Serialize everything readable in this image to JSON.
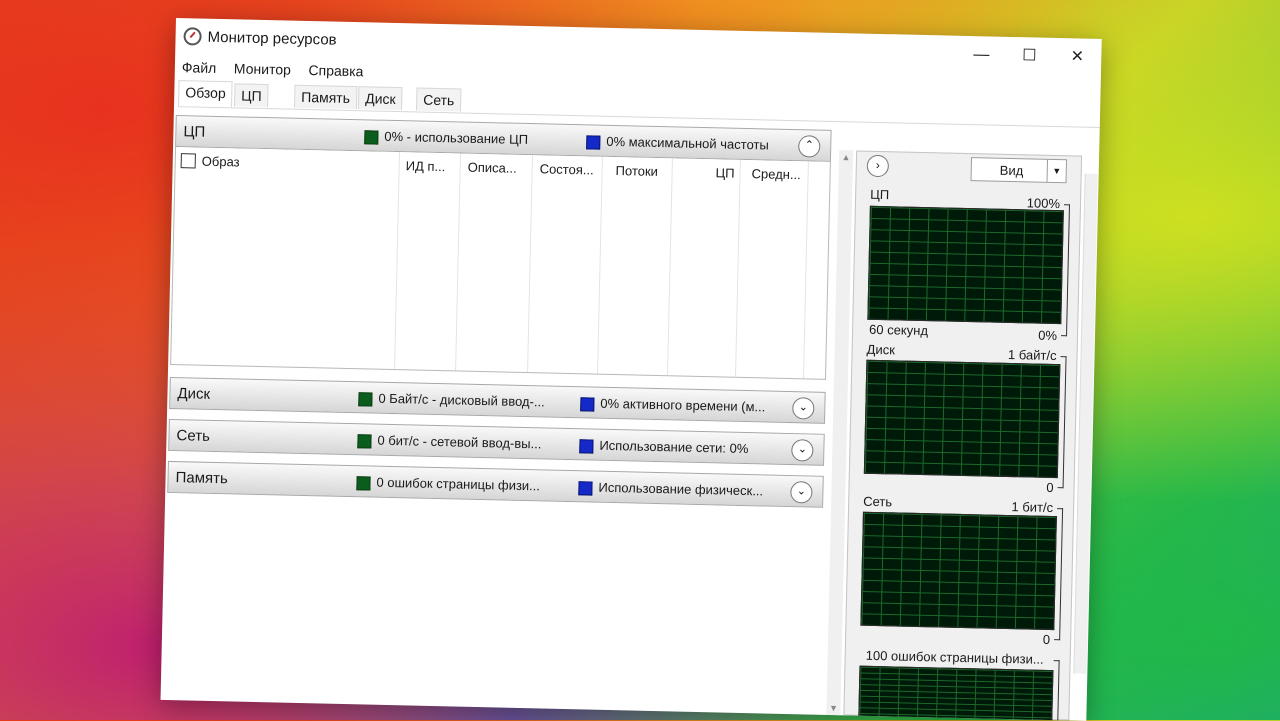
{
  "window": {
    "title": "Монитор ресурсов",
    "controls": {
      "minimize": "—",
      "maximize": "☐",
      "close": "✕"
    }
  },
  "menu": [
    "Файл",
    "Монитор",
    "Справка"
  ],
  "tabs": [
    "Обзор",
    "ЦП",
    "Память",
    "Диск",
    "Сеть"
  ],
  "active_tab": "Обзор",
  "sections": {
    "cpu": {
      "title": "ЦП",
      "green_text": "0% - использование ЦП",
      "blue_text": "0% максимальной частоты",
      "chevron": "⌃",
      "checkbox_label": "Образ",
      "columns": [
        "ИД п...",
        "Описа...",
        "Состоя...",
        "Потоки",
        "ЦП",
        "Средн..."
      ]
    },
    "disk": {
      "title": "Диск",
      "green_text": "0 Байт/с - дисковый ввод-...",
      "blue_text": "0% активного времени (м...",
      "chevron": "⌄"
    },
    "network": {
      "title": "Сеть",
      "green_text": "0 бит/с - сетевой ввод-вы...",
      "blue_text": "Использование сети: 0%",
      "chevron": "⌄"
    },
    "memory": {
      "title": "Память",
      "green_text": "0 ошибок страницы физи...",
      "blue_text": "Использование физическ...",
      "chevron": "⌄"
    }
  },
  "right_panel": {
    "arrow": "›",
    "view_label": "Вид",
    "view_dropdown": "▼",
    "graphs": [
      {
        "name": "ЦП",
        "max": "100%",
        "min": "0%",
        "time": "60 секунд"
      },
      {
        "name": "Диск",
        "max": "1 байт/с",
        "min": "0"
      },
      {
        "name": "Сеть",
        "max": "1 бит/с",
        "min": "0"
      },
      {
        "name": "100 ошибок страницы физи...",
        "max": ""
      }
    ]
  },
  "colors": {
    "green": "#0b5d1e",
    "blue": "#1429c8",
    "graph_bg": "#001a0a",
    "grid": "#1c6a2a"
  }
}
